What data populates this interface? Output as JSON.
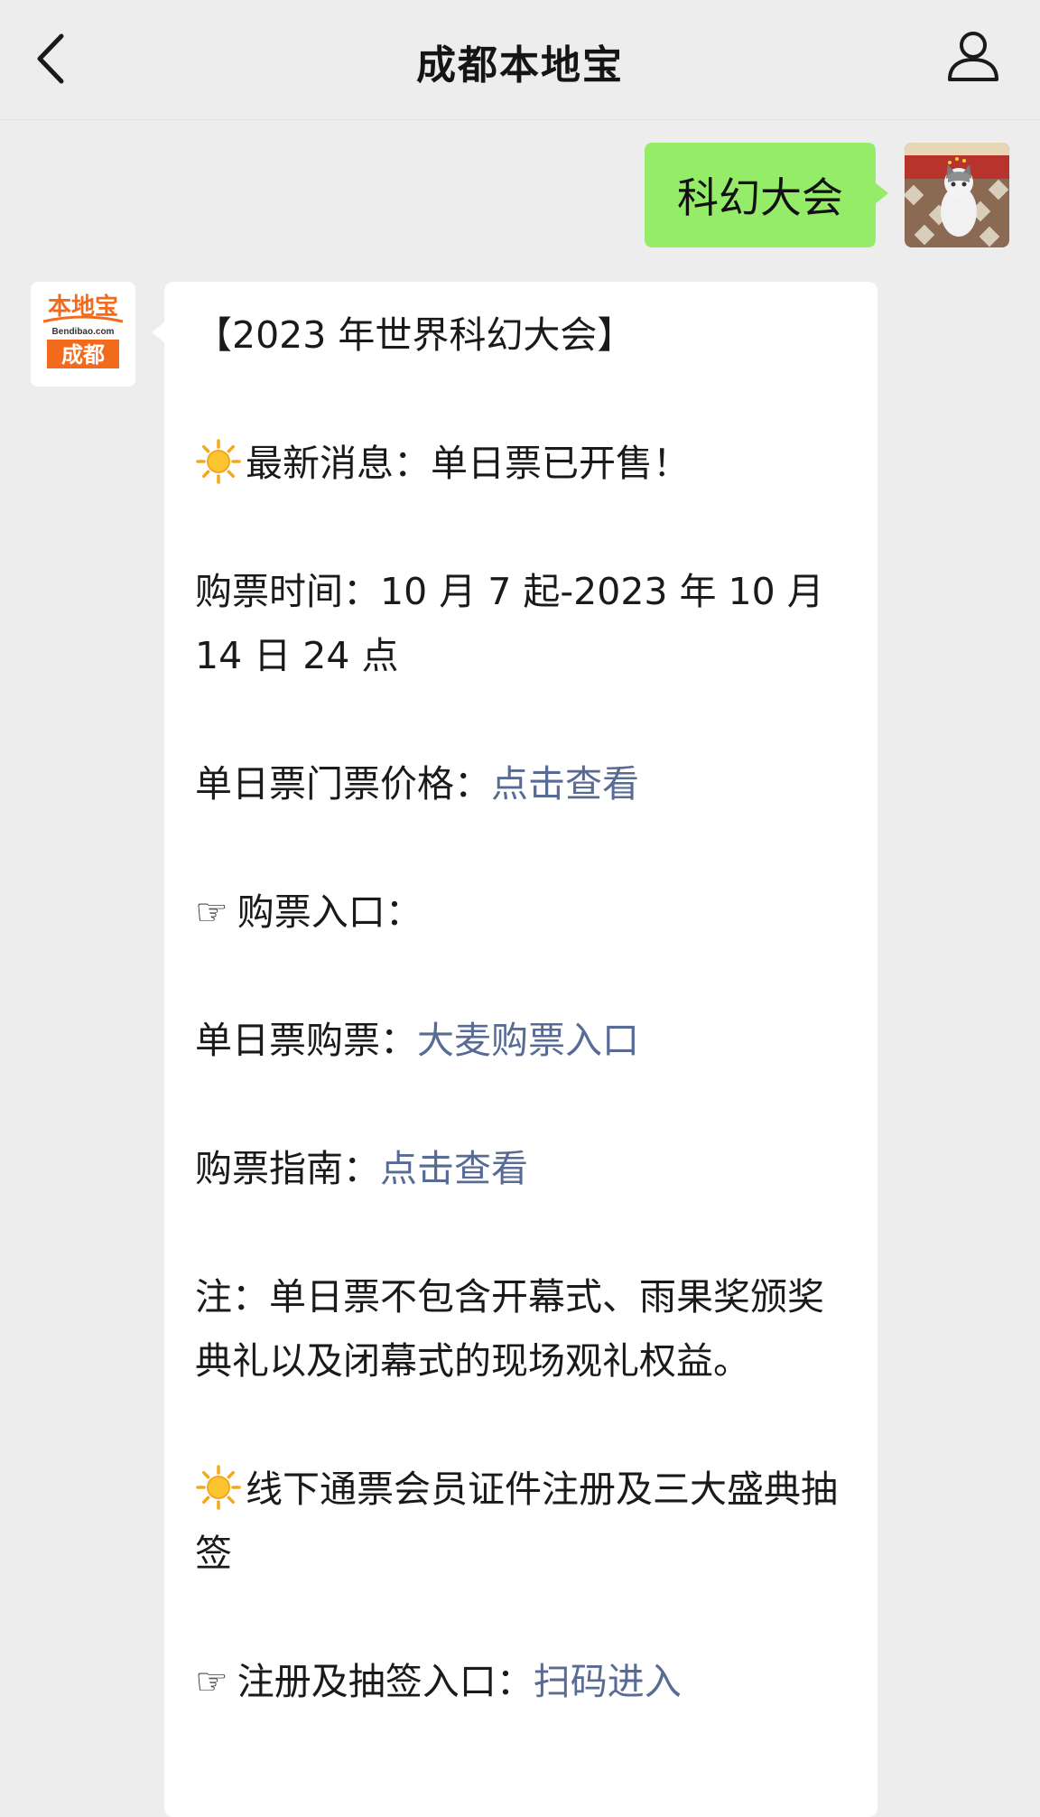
{
  "header": {
    "title": "成都本地宝"
  },
  "outgoing": {
    "text": "科幻大会"
  },
  "bot": {
    "logo_top": "本地宝",
    "logo_mid": "Bendibao.com",
    "logo_bottom": "成都"
  },
  "message": {
    "title": "【2023 年世界科幻大会】",
    "news_emoji": "sun-emoji",
    "news": "最新消息：单日票已开售！",
    "purchase_time": "购票时间：10 月 7 起-2023 年 10 月 14 日 24 点",
    "price_label": "单日票门票价格：",
    "price_link": "点击查看",
    "hand_symbol": "☞",
    "entry_heading": "购票入口：",
    "single_label": "单日票购票：",
    "single_link": "大麦购票入口",
    "guide_label": "购票指南：",
    "guide_link": "点击查看",
    "note": "注：单日票不包含开幕式、雨果奖颁奖典礼以及闭幕式的现场观礼权益。",
    "pass_heading": "线下通票会员证件注册及三大盛典抽签",
    "register_label": "注册及抽签入口：",
    "register_link": "扫码进入"
  },
  "colors": {
    "background": "#ededed",
    "outgoing_bubble": "#95ec69",
    "link": "#576b95",
    "brand_orange": "#f26b1d"
  }
}
